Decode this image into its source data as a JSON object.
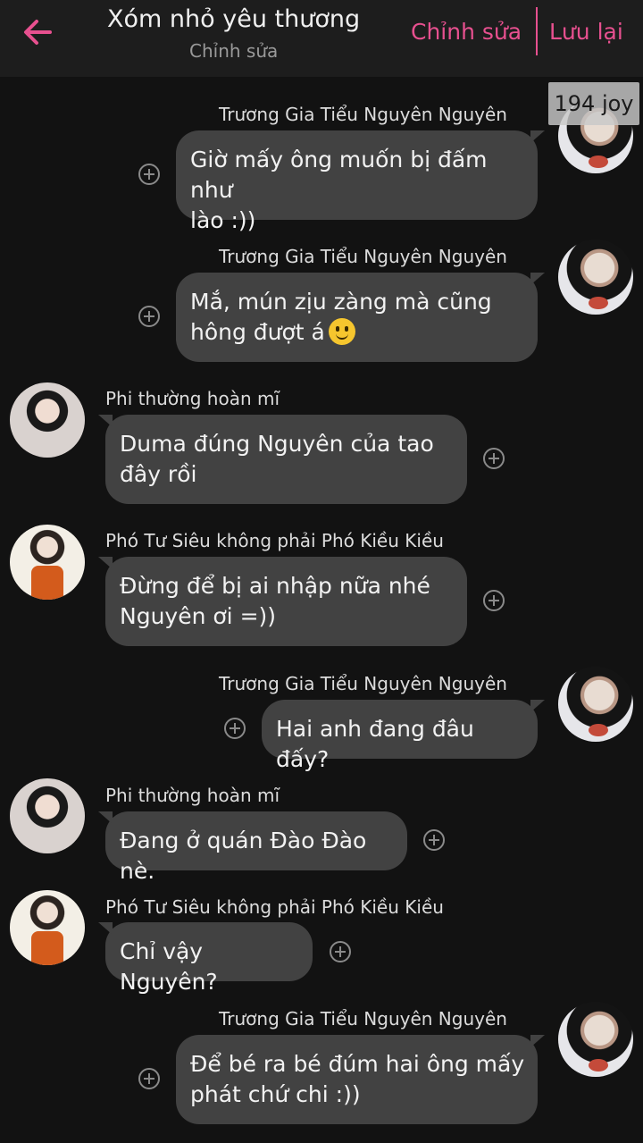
{
  "header": {
    "title": "Xóm nhỏ yêu thương",
    "subtitle": "Chỉnh sửa",
    "edit_label": "Chỉnh sửa",
    "save_label": "Lưu lại",
    "accent_color": "#e7508f"
  },
  "watermark": "194 joy",
  "messages": [
    {
      "sender": "Trương Gia Tiểu Nguyên Nguyên",
      "text_lines": [
        "Giờ mấy ông muốn bị đấm như",
        "lào :))"
      ]
    },
    {
      "sender": "Trương Gia Tiểu Nguyên Nguyên",
      "text_lines": [
        "Mắ, mún zịu zàng mà cũng",
        "hông đượt á"
      ],
      "emoji": "slightly-smiling-face"
    },
    {
      "sender": "Phi thường hoàn mĩ",
      "text_lines": [
        "Duma đúng Nguyên của tao",
        "đây rồi"
      ]
    },
    {
      "sender": "Phó Tư Siêu không phải Phó Kiều Kiều",
      "text_lines": [
        "Đừng để bị ai nhập nữa nhé",
        "Nguyên ơi =))"
      ]
    },
    {
      "sender": "Trương Gia Tiểu Nguyên Nguyên",
      "text_lines": [
        "Hai anh đang đâu đấy?"
      ]
    },
    {
      "sender": "Phi thường hoàn mĩ",
      "text_lines": [
        "Đang ở quán Đào Đào nè."
      ]
    },
    {
      "sender": "Phó Tư Siêu không phải Phó Kiều Kiều",
      "text_lines": [
        "Chỉ vậy Nguyên?"
      ]
    },
    {
      "sender": "Trương Gia Tiểu Nguyên Nguyên",
      "text_lines": [
        "Để bé ra bé đúm hai ông mấy",
        "phát chứ chi :))"
      ]
    }
  ]
}
